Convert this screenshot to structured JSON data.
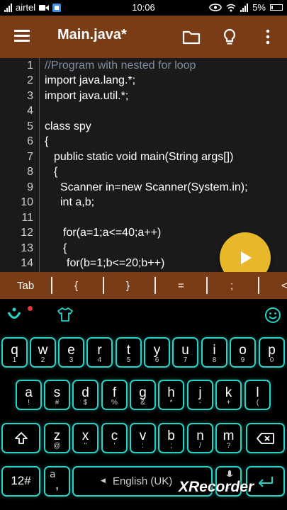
{
  "status_bar": {
    "carrier": "airtel",
    "time": "10:06",
    "battery": "5%",
    "icons": [
      "signal-icon",
      "video-icon",
      "app-icon",
      "eye-icon",
      "wifi-icon",
      "signal-icon",
      "battery-icon"
    ]
  },
  "toolbar": {
    "title": "Main.java*",
    "icons": [
      "menu-icon",
      "folder-icon",
      "lightbulb-icon",
      "more-vertical-icon"
    ],
    "color": "#7a3b17"
  },
  "editor": {
    "line_numbers": [
      "1",
      "2",
      "3",
      "4",
      "5",
      "6",
      "7",
      "8",
      "9",
      "10",
      "11",
      "12",
      "13",
      "14"
    ],
    "lines": [
      "//Program with nested for loop",
      "import java.lang.*;",
      "import java.util.*;",
      "",
      "class spy",
      "{",
      "public static void main(String args[])",
      "{",
      "Scanner in=new Scanner(System.in);",
      "int a,b;",
      "",
      "for(a=1;a<=40;a++)",
      "{",
      "for(b=1;b<=20;b++)"
    ],
    "run_button_icon": "play-icon",
    "run_button_color": "#e9b82a"
  },
  "symbol_bar": {
    "items": [
      "Tab",
      "{",
      "}",
      "=",
      ";",
      "<"
    ]
  },
  "keyboard": {
    "row1": [
      {
        "key": "q",
        "sub": "1"
      },
      {
        "key": "w",
        "sub": "2"
      },
      {
        "key": "e",
        "sub": "3"
      },
      {
        "key": "r",
        "sub": "4"
      },
      {
        "key": "t",
        "sub": "5"
      },
      {
        "key": "y",
        "sub": "6"
      },
      {
        "key": "u",
        "sub": "7"
      },
      {
        "key": "i",
        "sub": "8"
      },
      {
        "key": "o",
        "sub": "9"
      },
      {
        "key": "p",
        "sub": "0"
      }
    ],
    "row2": [
      {
        "key": "a",
        "sub": "!"
      },
      {
        "key": "s",
        "sub": "#"
      },
      {
        "key": "d",
        "sub": "$"
      },
      {
        "key": "f",
        "sub": "%"
      },
      {
        "key": "g",
        "sub": "&"
      },
      {
        "key": "h",
        "sub": "*"
      },
      {
        "key": "j",
        "sub": "-"
      },
      {
        "key": "k",
        "sub": "+"
      },
      {
        "key": "l",
        "sub": "("
      }
    ],
    "row3": [
      {
        "key": "z",
        "sub": "@"
      },
      {
        "key": "x",
        "sub": "\""
      },
      {
        "key": "c",
        "sub": "'"
      },
      {
        "key": "v",
        "sub": ":"
      },
      {
        "key": "b",
        "sub": ";"
      },
      {
        "key": "n",
        "sub": "/"
      },
      {
        "key": "m",
        "sub": "?"
      }
    ],
    "numbers_key": "12#",
    "comma_key": ",",
    "comma_alt": "a",
    "space_label": "English (UK)",
    "period_key": ".",
    "accent_color": "#27d3c6"
  },
  "watermark": "XRecorder"
}
